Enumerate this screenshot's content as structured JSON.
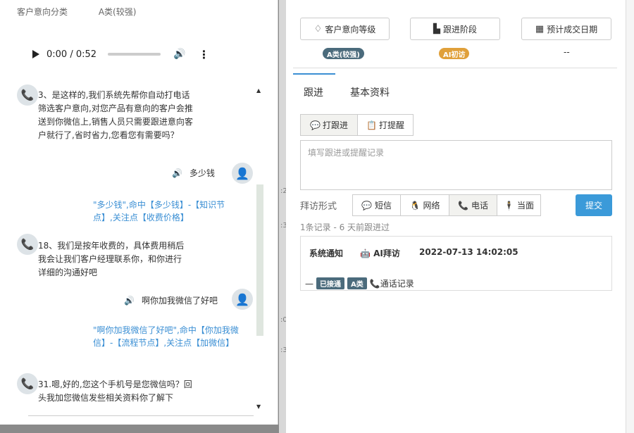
{
  "left": {
    "intent_label": "客户意向分类",
    "intent_value": "A类(较强)",
    "audio": {
      "time": "0:00 / 0:52"
    },
    "messages": [
      {
        "type": "bot",
        "text": "3、是这样的,我们系统先帮你自动打电话筛选客户意向,对您产品有意向的客户会推送到你微信上,销售人员只需要跟进意向客户就行了,省时省力,您看您有需要吗？"
      },
      {
        "type": "user",
        "text": "多少钱"
      },
      {
        "type": "hit",
        "text": "\"多少钱\",命中【多少钱】-【知识节点】,关注点【收费价格】"
      },
      {
        "type": "bot",
        "text": "18、我们是按年收费的，具体费用稍后我会让我们客户经理联系你，和你进行详细的沟通好吧"
      },
      {
        "type": "user",
        "text": "啊你加我微信了好吧"
      },
      {
        "type": "hit",
        "text": "\"啊你加我微信了好吧\",命中【你加我微信】-【流程节点】,关注点【加微信】"
      },
      {
        "type": "bot",
        "text": "31.嗯,好的,您这个手机号是您微信吗？回头我加您微信发些相关资料你了解下"
      }
    ]
  },
  "strip_nums": [
    ":2",
    ":3",
    ":0",
    ":3"
  ],
  "right": {
    "top_buttons": [
      {
        "label": "客户意向等级",
        "icon": "diamond-icon",
        "glyph": "♢"
      },
      {
        "label": "跟进阶段",
        "icon": "factory-icon",
        "glyph": "▙"
      },
      {
        "label": "预计成交日期",
        "icon": "calculator-icon",
        "glyph": "▦"
      }
    ],
    "badges": {
      "level": {
        "text": "A类(较强)",
        "color": "#4b6b7c"
      },
      "stage": {
        "text": "AI初访",
        "color": "#e0a03a"
      },
      "date": "--"
    },
    "tabs": [
      "跟进",
      "基本资料"
    ],
    "sub_buttons": [
      {
        "label": "打跟进",
        "icon": "comment-icon",
        "glyph": "💬"
      },
      {
        "label": "打提醒",
        "icon": "clipboard-icon",
        "glyph": "📋"
      }
    ],
    "textarea_placeholder": "填写跟进或提醒记录",
    "visit_label": "拜访形式",
    "visit_buttons": [
      {
        "label": "短信",
        "icon": "message-icon",
        "glyph": "💬"
      },
      {
        "label": "网络",
        "icon": "qq-icon",
        "glyph": "🐧"
      },
      {
        "label": "电话",
        "icon": "phone-icon",
        "glyph": "📞"
      },
      {
        "label": "当面",
        "icon": "person-icon",
        "glyph": "🕴"
      }
    ],
    "submit_label": "提交",
    "record_count": "1条记录 - 6 天前跟进过",
    "record": {
      "type": "系统通知",
      "robot": "AI拜访",
      "time": "2022-07-13 14:02:05",
      "dash": "—",
      "status_tag": "已接通",
      "level_tag": "A类",
      "call_label": "通话记录"
    }
  }
}
